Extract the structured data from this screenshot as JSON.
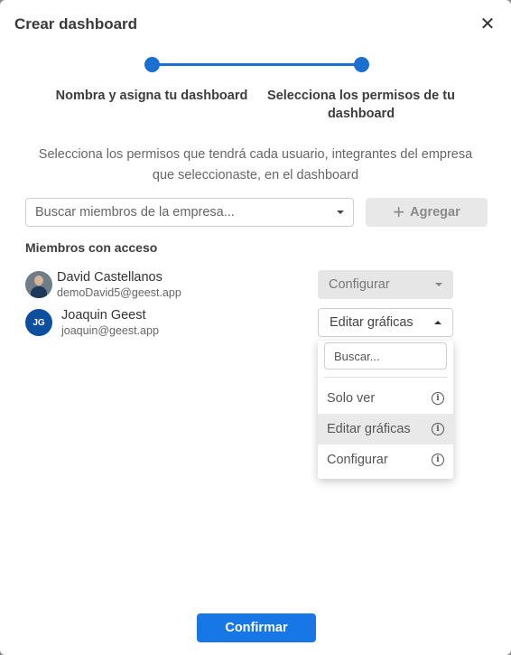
{
  "modal": {
    "title": "Crear dashboard",
    "close_label": "✕"
  },
  "stepper": {
    "steps": [
      {
        "label": "Nombra y asigna tu dashboard",
        "completed": true
      },
      {
        "label": "Selecciona los permisos de tu dashboard",
        "completed": true
      }
    ]
  },
  "description": "Selecciona los permisos que tendrá cada usuario, integrantes del empresa que seleccionaste, en el dashboard",
  "member_search": {
    "placeholder": "Buscar miembros de la empresa..."
  },
  "add_button": {
    "icon": "plus-icon",
    "label": "Agregar"
  },
  "members_section": {
    "title": "Miembros con acceso",
    "members": [
      {
        "name": "David Castellanos",
        "email": "demoDavid5@geest.app",
        "avatar_type": "photo",
        "permission": "Configurar",
        "permission_disabled": true
      },
      {
        "name": "Joaquin Geest",
        "email": "joaquin@geest.app",
        "avatar_type": "initials",
        "initials": "JG",
        "permission": "Editar gráficas",
        "permission_disabled": false
      }
    ]
  },
  "permission_dropdown": {
    "search_placeholder": "Buscar...",
    "options": [
      {
        "label": "Solo ver",
        "info_icon": "info-icon",
        "selected": false
      },
      {
        "label": "Editar gráficas",
        "info_icon": "info-icon",
        "selected": true
      },
      {
        "label": "Configurar",
        "info_icon": "info-icon",
        "selected": false
      }
    ]
  },
  "confirm_button": {
    "label": "Confirmar"
  },
  "colors": {
    "primary": "#1777e6",
    "stepper": "#1a6fd1",
    "avatar_initials_bg": "#0d4f9e",
    "disabled_bg": "#e6e6e6"
  }
}
